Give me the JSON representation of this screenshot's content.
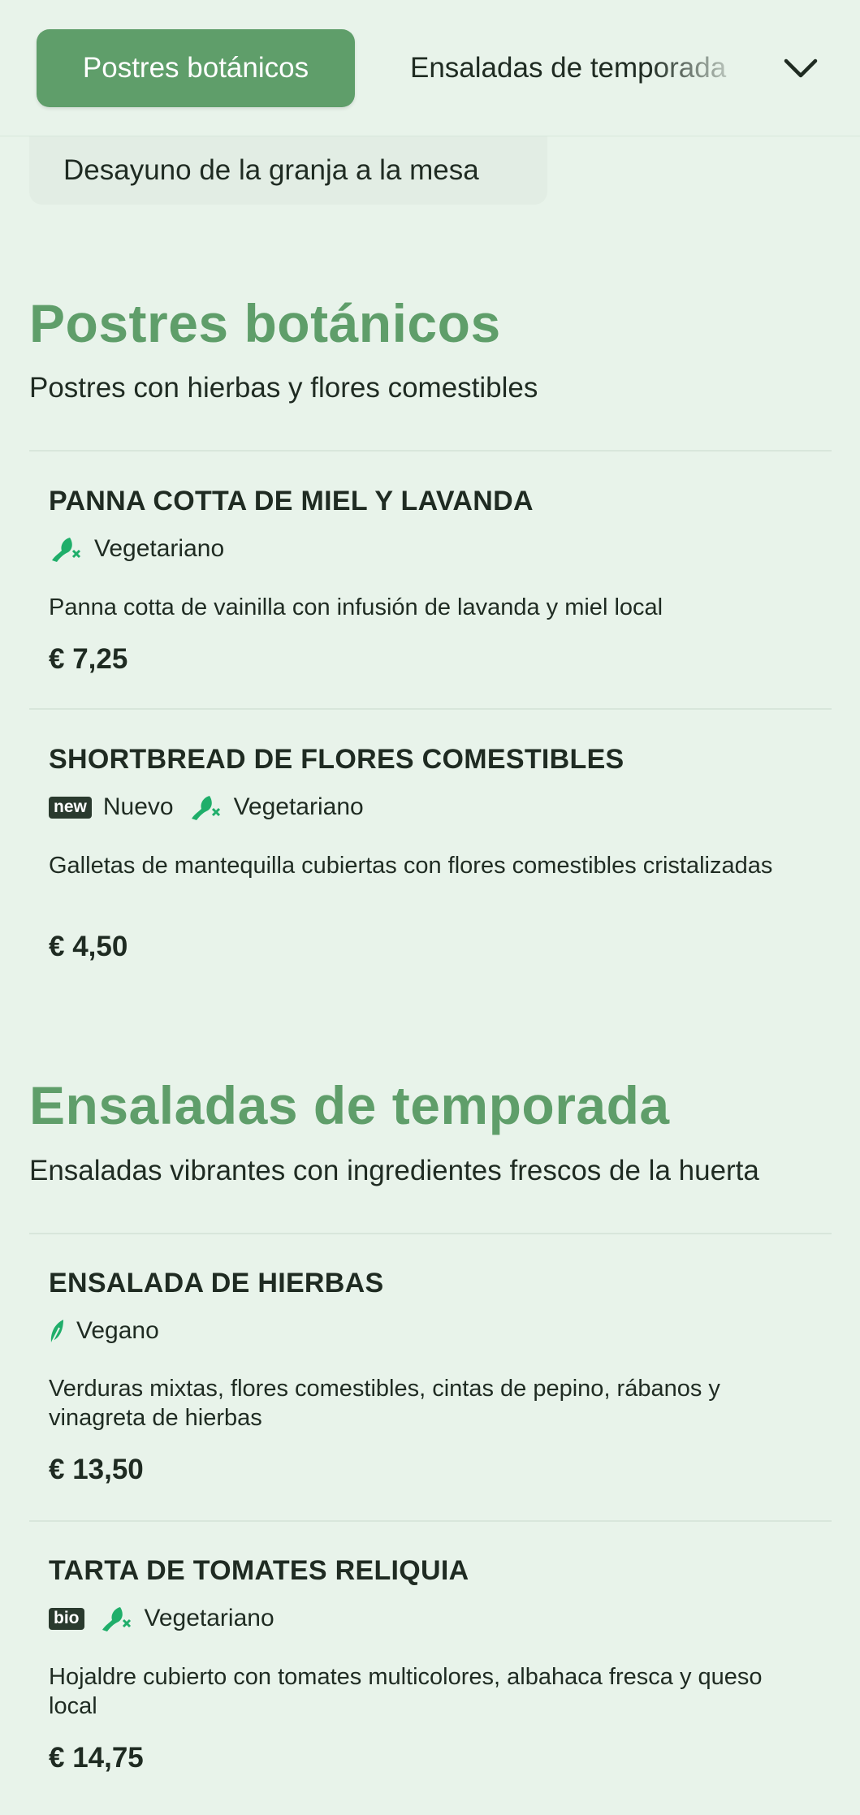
{
  "nav": {
    "active_category": "Postres botánicos",
    "next_category": "Ensaladas de temporada",
    "secondary_category": "Desayuno de la granja a la mesa",
    "expand_icon": "chevron-down-icon"
  },
  "sections": [
    {
      "title": "Postres botánicos",
      "description": "Postres con hierbas y flores comestibles",
      "items": [
        {
          "name": "PANNA COTTA DE MIEL Y LAVANDA",
          "tags": [
            {
              "icon": "vegetarian-icon",
              "label": "Vegetariano"
            }
          ],
          "description": "Panna cotta de vainilla con infusión de lavanda y miel local",
          "price": "€ 7,25"
        },
        {
          "name": "SHORTBREAD DE FLORES COMESTIBLES",
          "badge": "new",
          "tags": [
            {
              "label": "Nuevo"
            },
            {
              "icon": "vegetarian-icon",
              "label": "Vegetariano"
            }
          ],
          "description": "Galletas de mantequilla cubiertas con flores comestibles cristalizadas",
          "price": "€ 4,50"
        }
      ]
    },
    {
      "title": "Ensaladas de temporada",
      "description": "Ensaladas vibrantes con ingredientes frescos de la huerta",
      "items": [
        {
          "name": "ENSALADA DE HIERBAS",
          "tags": [
            {
              "icon": "vegan-leaf-icon",
              "label": "Vegano"
            }
          ],
          "description": "Verduras mixtas, flores comestibles, cintas de pepino, rábanos y vinagreta de hierbas",
          "price": "€ 13,50"
        },
        {
          "name": "TARTA DE TOMATES RELIQUIA",
          "badge": "bio",
          "tags": [
            {
              "icon": "vegetarian-icon",
              "label": "Vegetariano"
            }
          ],
          "description": "Hojaldre cubierto con tomates multicolores, albahaca fresca y queso local",
          "price": "€ 14,75"
        }
      ]
    }
  ],
  "colors": {
    "background": "#e8f3ea",
    "accent": "#5f9e6a",
    "icon_green": "#1fae6a",
    "text": "#1f2b22",
    "badge_bg": "#2a3a2e"
  }
}
